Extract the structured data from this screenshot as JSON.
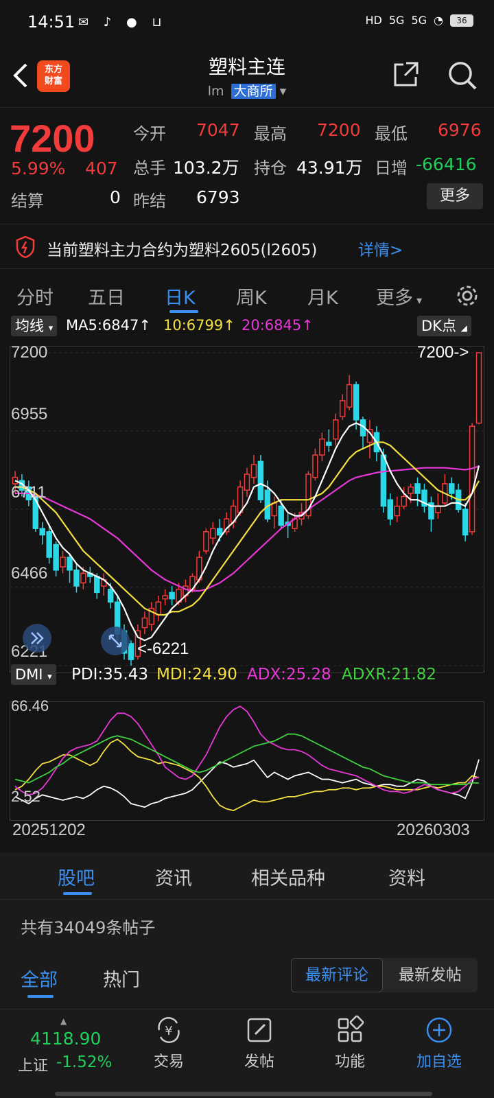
{
  "status": {
    "time": "14:51",
    "hd": "HD",
    "net1": "5G",
    "net2": "5G",
    "battery": "36"
  },
  "header": {
    "title": "塑料主连",
    "code": "lm",
    "exchange": "大商所",
    "logo_line1": "东方",
    "logo_line2": "财富"
  },
  "quote": {
    "price": "7200",
    "pct": "5.99%",
    "change": "407",
    "settle_label": "结算",
    "settle": "0",
    "open_label": "今开",
    "open": "7047",
    "high_label": "最高",
    "high": "7200",
    "low_label": "最低",
    "low": "6976",
    "vol_label": "总手",
    "vol": "103.2万",
    "oi_label": "持仓",
    "oi": "43.91万",
    "daychg_label": "日增",
    "daychg": "-66416",
    "prevsettle_label": "昨结",
    "prevsettle": "6793",
    "more": "更多"
  },
  "notice": {
    "text": "当前塑料主力合约为塑料2605(l2605)",
    "link": "详情>"
  },
  "tabs": [
    "分时",
    "五日",
    "日K",
    "周K",
    "月K",
    "更多"
  ],
  "indicator": {
    "ma_select": "均线",
    "ma5": "MA5:6847↑",
    "ma10": "10:6799↑",
    "ma20": "20:6845↑",
    "dk": "DK点",
    "price_marker_high": "7200->",
    "price_marker_low": "<-6221",
    "dmi_select": "DMI",
    "pdi": "PDI:35.43",
    "mdi": "MDI:24.90",
    "adx": "ADX:25.28",
    "adxr": "ADXR:21.82",
    "date_start": "20251202",
    "date_end": "20260303"
  },
  "colors": {
    "up": "#f23b3b",
    "down": "#2ad8e8",
    "ma5": "#ffffff",
    "ma10": "#f5e042",
    "ma20": "#e838d8",
    "adx": "#e838d8",
    "adxr": "#3fd03f"
  },
  "chart_data": [
    {
      "type": "candlestick",
      "yticks": [
        "7200",
        "6955",
        "6711",
        "6466",
        "6221"
      ],
      "ylim": [
        6221,
        7200
      ],
      "marked_high": 7200,
      "marked_low": 6221,
      "candles": [
        [
          6790,
          6810,
          6760,
          6830
        ],
        [
          6800,
          6770,
          6750,
          6820
        ],
        [
          6780,
          6740,
          6720,
          6800
        ],
        [
          6750,
          6650,
          6640,
          6760
        ],
        [
          6650,
          6630,
          6600,
          6670
        ],
        [
          6640,
          6560,
          6540,
          6660
        ],
        [
          6600,
          6520,
          6500,
          6610
        ],
        [
          6530,
          6560,
          6510,
          6580
        ],
        [
          6560,
          6520,
          6480,
          6570
        ],
        [
          6520,
          6470,
          6450,
          6540
        ],
        [
          6480,
          6510,
          6460,
          6530
        ],
        [
          6510,
          6500,
          6480,
          6530
        ],
        [
          6500,
          6450,
          6430,
          6510
        ],
        [
          6470,
          6490,
          6440,
          6510
        ],
        [
          6460,
          6420,
          6400,
          6480
        ],
        [
          6420,
          6320,
          6300,
          6440
        ],
        [
          6330,
          6260,
          6240,
          6350
        ],
        [
          6290,
          6240,
          6221,
          6300
        ],
        [
          6250,
          6330,
          6240,
          6350
        ],
        [
          6340,
          6370,
          6320,
          6390
        ],
        [
          6350,
          6400,
          6330,
          6420
        ],
        [
          6380,
          6420,
          6360,
          6440
        ],
        [
          6430,
          6440,
          6410,
          6460
        ],
        [
          6450,
          6430,
          6410,
          6470
        ],
        [
          6420,
          6460,
          6410,
          6480
        ],
        [
          6440,
          6470,
          6420,
          6490
        ],
        [
          6460,
          6500,
          6450,
          6510
        ],
        [
          6490,
          6560,
          6480,
          6580
        ],
        [
          6580,
          6640,
          6570,
          6650
        ],
        [
          6620,
          6650,
          6600,
          6670
        ],
        [
          6650,
          6630,
          6610,
          6680
        ],
        [
          6640,
          6680,
          6630,
          6700
        ],
        [
          6670,
          6720,
          6650,
          6740
        ],
        [
          6700,
          6780,
          6690,
          6800
        ],
        [
          6770,
          6820,
          6750,
          6840
        ],
        [
          6810,
          6850,
          6790,
          6880
        ],
        [
          6860,
          6740,
          6730,
          6880
        ],
        [
          6770,
          6680,
          6670,
          6800
        ],
        [
          6690,
          6730,
          6650,
          6750
        ],
        [
          6720,
          6660,
          6650,
          6740
        ],
        [
          6670,
          6660,
          6620,
          6700
        ],
        [
          6650,
          6680,
          6640,
          6700
        ],
        [
          6680,
          6700,
          6660,
          6730
        ],
        [
          6690,
          6820,
          6680,
          6830
        ],
        [
          6810,
          6880,
          6800,
          6900
        ],
        [
          6880,
          6930,
          6860,
          6950
        ],
        [
          6920,
          6910,
          6890,
          6960
        ],
        [
          6930,
          6990,
          6910,
          7010
        ],
        [
          7000,
          7050,
          6990,
          7070
        ],
        [
          7030,
          7100,
          7020,
          7130
        ],
        [
          7100,
          6990,
          6960,
          7110
        ],
        [
          6990,
          6940,
          6900,
          7000
        ],
        [
          6920,
          6960,
          6870,
          6990
        ],
        [
          6950,
          6890,
          6860,
          6970
        ],
        [
          6880,
          6720,
          6700,
          6900
        ],
        [
          6740,
          6680,
          6660,
          6760
        ],
        [
          6690,
          6720,
          6670,
          6750
        ],
        [
          6720,
          6750,
          6710,
          6780
        ],
        [
          6760,
          6780,
          6730,
          6790
        ],
        [
          6790,
          6760,
          6720,
          6810
        ],
        [
          6770,
          6720,
          6700,
          6790
        ],
        [
          6730,
          6680,
          6640,
          6750
        ],
        [
          6700,
          6720,
          6680,
          6760
        ],
        [
          6730,
          6790,
          6720,
          6820
        ],
        [
          6790,
          6760,
          6740,
          6810
        ],
        [
          6770,
          6710,
          6700,
          6790
        ],
        [
          6710,
          6630,
          6610,
          6730
        ],
        [
          6640,
          6970,
          6630,
          6980
        ],
        [
          6980,
          7200,
          6976,
          7200
        ]
      ],
      "ma5": [
        6800,
        6790,
        6770,
        6740,
        6700,
        6660,
        6620,
        6590,
        6570,
        6540,
        6520,
        6510,
        6500,
        6490,
        6470,
        6440,
        6400,
        6350,
        6310,
        6300,
        6310,
        6340,
        6370,
        6400,
        6420,
        6440,
        6460,
        6490,
        6530,
        6580,
        6620,
        6650,
        6670,
        6700,
        6730,
        6780,
        6790,
        6780,
        6760,
        6730,
        6700,
        6690,
        6690,
        6710,
        6750,
        6800,
        6850,
        6900,
        6940,
        6970,
        6980,
        6970,
        6950,
        6920,
        6880,
        6830,
        6790,
        6760,
        6740,
        6740,
        6730,
        6720,
        6720,
        6720,
        6730,
        6730,
        6720,
        6760,
        6847
      ],
      "ma10": [
        6780,
        6780,
        6770,
        6760,
        6740,
        6720,
        6700,
        6670,
        6640,
        6610,
        6580,
        6560,
        6540,
        6520,
        6500,
        6480,
        6460,
        6440,
        6420,
        6400,
        6390,
        6380,
        6380,
        6390,
        6390,
        6400,
        6410,
        6430,
        6460,
        6490,
        6520,
        6550,
        6580,
        6610,
        6640,
        6670,
        6700,
        6720,
        6730,
        6740,
        6740,
        6740,
        6740,
        6740,
        6750,
        6760,
        6780,
        6810,
        6840,
        6870,
        6890,
        6900,
        6910,
        6920,
        6920,
        6910,
        6890,
        6870,
        6850,
        6830,
        6810,
        6790,
        6770,
        6760,
        6750,
        6740,
        6740,
        6760,
        6799
      ],
      "ma20": [
        6760,
        6760,
        6760,
        6755,
        6750,
        6740,
        6730,
        6720,
        6710,
        6700,
        6690,
        6680,
        6665,
        6650,
        6635,
        6620,
        6600,
        6580,
        6560,
        6540,
        6520,
        6505,
        6490,
        6480,
        6470,
        6460,
        6455,
        6455,
        6460,
        6470,
        6480,
        6495,
        6510,
        6530,
        6550,
        6570,
        6590,
        6610,
        6630,
        6650,
        6665,
        6680,
        6695,
        6710,
        6725,
        6740,
        6755,
        6770,
        6785,
        6800,
        6810,
        6815,
        6820,
        6825,
        6828,
        6830,
        6832,
        6834,
        6836,
        6838,
        6840,
        6840,
        6840,
        6840,
        6838,
        6836,
        6834,
        6838,
        6845
      ]
    },
    {
      "type": "line",
      "yticks": [
        "66.46",
        "2.52"
      ],
      "ylim": [
        2.52,
        66.46
      ],
      "series": [
        {
          "name": "PDI",
          "values": [
            14,
            12,
            10,
            13,
            15,
            14,
            13,
            12,
            13,
            14,
            13,
            15,
            18,
            20,
            19,
            17,
            14,
            10,
            9,
            8,
            10,
            11,
            13,
            14,
            15,
            16,
            18,
            22,
            26,
            30,
            34,
            33,
            31,
            32,
            33,
            35,
            30,
            25,
            28,
            26,
            24,
            26,
            27,
            28,
            26,
            24,
            24,
            23,
            22,
            23,
            24,
            22,
            21,
            20,
            21,
            21,
            20,
            20,
            22,
            24,
            23,
            20,
            18,
            17,
            16,
            15,
            13,
            22,
            35.43
          ]
        },
        {
          "name": "MDI",
          "values": [
            18,
            20,
            24,
            29,
            33,
            34,
            36,
            38,
            38,
            36,
            34,
            32,
            34,
            40,
            45,
            47,
            44,
            40,
            37,
            36,
            35,
            33,
            34,
            33,
            32,
            30,
            28,
            25,
            20,
            14,
            9,
            7,
            6,
            8,
            10,
            12,
            11,
            11,
            12,
            13,
            14,
            14,
            15,
            16,
            17,
            17,
            18,
            18,
            19,
            19,
            18,
            19,
            19,
            20,
            20,
            19,
            18,
            18,
            18,
            18,
            19,
            20,
            19,
            20,
            21,
            22,
            22,
            26,
            24.9
          ]
        },
        {
          "name": "ADX",
          "values": [
            20,
            17,
            15,
            16,
            19,
            24,
            30,
            36,
            40,
            42,
            43,
            44,
            46,
            52,
            58,
            62,
            62,
            60,
            56,
            50,
            44,
            38,
            31,
            28,
            25,
            24,
            26,
            32,
            38,
            46,
            54,
            60,
            64,
            66,
            63,
            57,
            50,
            46,
            44,
            42,
            41,
            41,
            40,
            38,
            35,
            32,
            30,
            29,
            28,
            27,
            26,
            24,
            22,
            20,
            18,
            17,
            17,
            16,
            17,
            19,
            21,
            20,
            18,
            17,
            16,
            17,
            20,
            24,
            25.28
          ]
        },
        {
          "name": "ADXR",
          "values": [
            24,
            23,
            22,
            24,
            26,
            28,
            31,
            33,
            36,
            38,
            40,
            42,
            44,
            46,
            48,
            49,
            48,
            47,
            45,
            43,
            41,
            39,
            37,
            35,
            33,
            31,
            29,
            28,
            29,
            31,
            33,
            35,
            37,
            39,
            41,
            43,
            44,
            45,
            46,
            48,
            50,
            50,
            49,
            47,
            45,
            43,
            41,
            39,
            37,
            35,
            33,
            31,
            30,
            28,
            26,
            25,
            24,
            23,
            22,
            22,
            22,
            21,
            21,
            21,
            21,
            21,
            21,
            22,
            21.82
          ]
        }
      ]
    }
  ],
  "subtabs": [
    "股吧",
    "资讯",
    "相关品种",
    "资料"
  ],
  "posts": {
    "count_text": "共有34049条帖子",
    "tab_all": "全部",
    "tab_hot": "热门",
    "sort_latest_comment": "最新评论",
    "sort_latest_post": "最新发帖"
  },
  "bottomnav": {
    "index_value": "4118.90",
    "index_name": "上证",
    "index_change": "-1.52%",
    "trade": "交易",
    "post": "发帖",
    "func": "功能",
    "add": "加自选"
  }
}
